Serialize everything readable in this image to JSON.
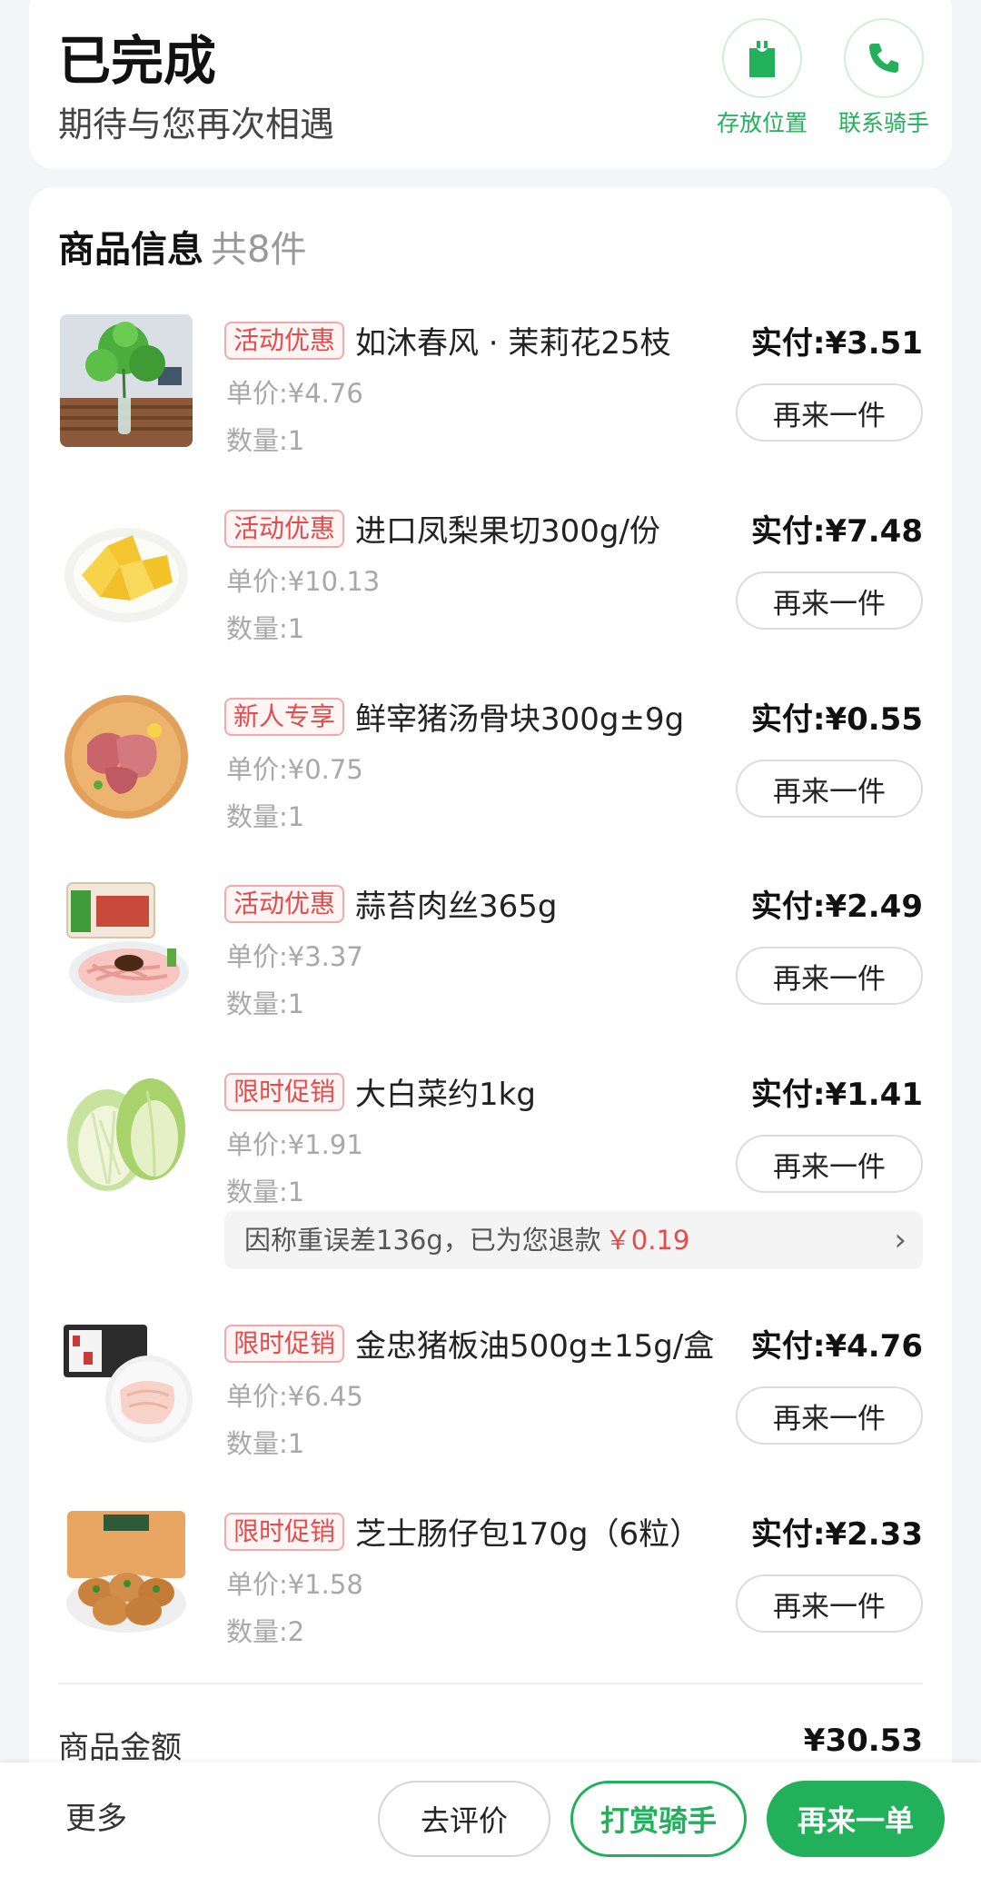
{
  "status": {
    "title": "已完成",
    "subtitle": "期待与您再次相遇",
    "storage_label": "存放位置",
    "rider_label": "联系骑手",
    "accent_color": "#22b15a"
  },
  "goods": {
    "title": "商品信息",
    "count": "共8件",
    "again_label": "再来一件",
    "items": [
      {
        "tag": "活动优惠",
        "name": "如沐春风 · 茉莉花25枝",
        "paid": "实付:¥3.51",
        "unit_price": "单价:¥4.76",
        "qty": "数量:1",
        "thumb_icon": "jasmine-flower-photo"
      },
      {
        "tag": "活动优惠",
        "name": "进口凤梨果切300g/份",
        "paid": "实付:¥7.48",
        "unit_price": "单价:¥10.13",
        "qty": "数量:1",
        "thumb_icon": "pineapple-slices-photo"
      },
      {
        "tag": "新人专享",
        "name": "鲜宰猪汤骨块300g±9g",
        "paid": "实付:¥0.55",
        "unit_price": "单价:¥0.75",
        "qty": "数量:1",
        "thumb_icon": "pork-bone-photo"
      },
      {
        "tag": "活动优惠",
        "name": "蒜苔肉丝365g",
        "paid": "实付:¥2.49",
        "unit_price": "单价:¥3.37",
        "qty": "数量:1",
        "thumb_icon": "shredded-pork-photo"
      },
      {
        "tag": "限时促销",
        "name": "大白菜约1kg",
        "paid": "实付:¥1.41",
        "unit_price": "单价:¥1.91",
        "qty": "数量:1",
        "thumb_icon": "cabbage-photo"
      },
      {
        "tag": "限时促销",
        "name": "金忠猪板油500g±15g/盒",
        "paid": "实付:¥4.76",
        "unit_price": "单价:¥6.45",
        "qty": "数量:1",
        "thumb_icon": "pork-fat-photo"
      },
      {
        "tag": "限时促销",
        "name": "芝士肠仔包170g（6粒）",
        "paid": "实付:¥2.33",
        "unit_price": "单价:¥1.58",
        "qty": "数量:2",
        "thumb_icon": "sausage-bun-photo"
      }
    ],
    "refund_note": {
      "text": "因称重误差136g，已为您退款",
      "amount": "￥0.19"
    },
    "total_label": "商品金额",
    "total_amount": "¥30.53"
  },
  "bottom_bar": {
    "more": "更多",
    "review": "去评价",
    "tip_rider": "打赏骑手",
    "reorder": "再来一单"
  }
}
